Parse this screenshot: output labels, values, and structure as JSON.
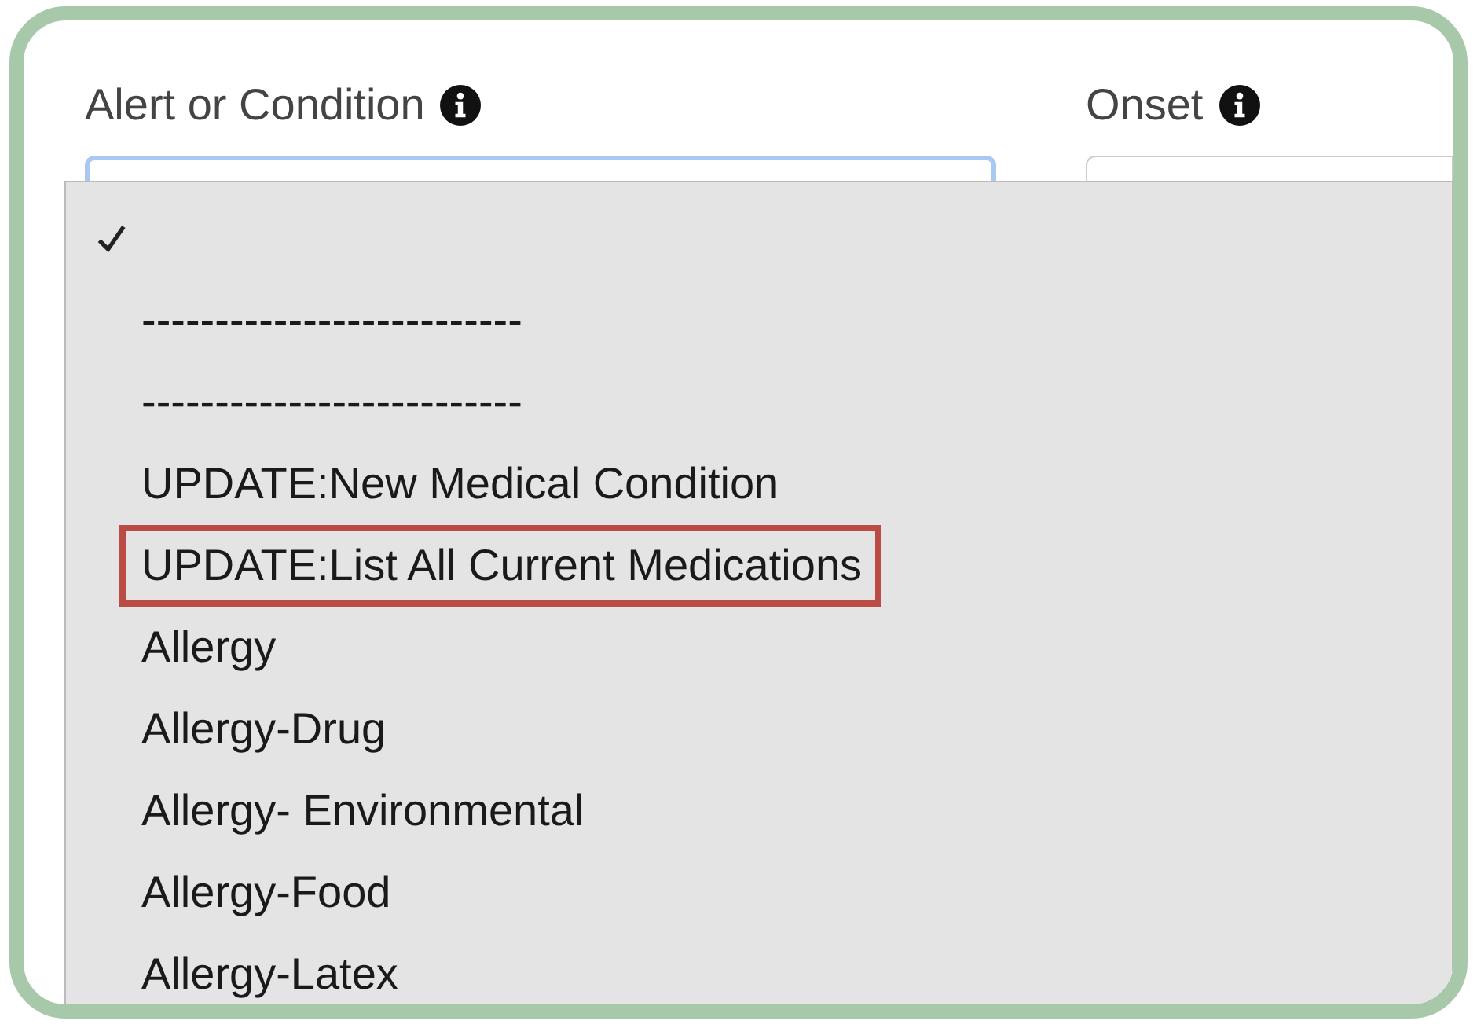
{
  "fields": [
    {
      "label": "Alert or Condition",
      "info": true,
      "focused": true
    },
    {
      "label": "Onset",
      "info": true,
      "focused": false
    }
  ],
  "dropdown": {
    "options": [
      {
        "checked": true,
        "highlighted": false
      },
      {
        "label": "--------------------------",
        "checked": false,
        "highlighted": false
      },
      {
        "label": "--------------------------",
        "checked": false,
        "highlighted": false
      },
      {
        "label": "UPDATE:New Medical Condition",
        "checked": false,
        "highlighted": false
      },
      {
        "label": "UPDATE:List All Current Medications",
        "checked": false,
        "highlighted": true
      },
      {
        "label": "Allergy",
        "checked": false,
        "highlighted": false
      },
      {
        "label": "Allergy-Drug",
        "checked": false,
        "highlighted": false
      },
      {
        "label": "Allergy- Environmental",
        "checked": false,
        "highlighted": false
      },
      {
        "label": "Allergy-Food",
        "checked": false,
        "highlighted": false
      },
      {
        "label": "Allergy-Latex",
        "checked": false,
        "highlighted": false
      }
    ]
  }
}
